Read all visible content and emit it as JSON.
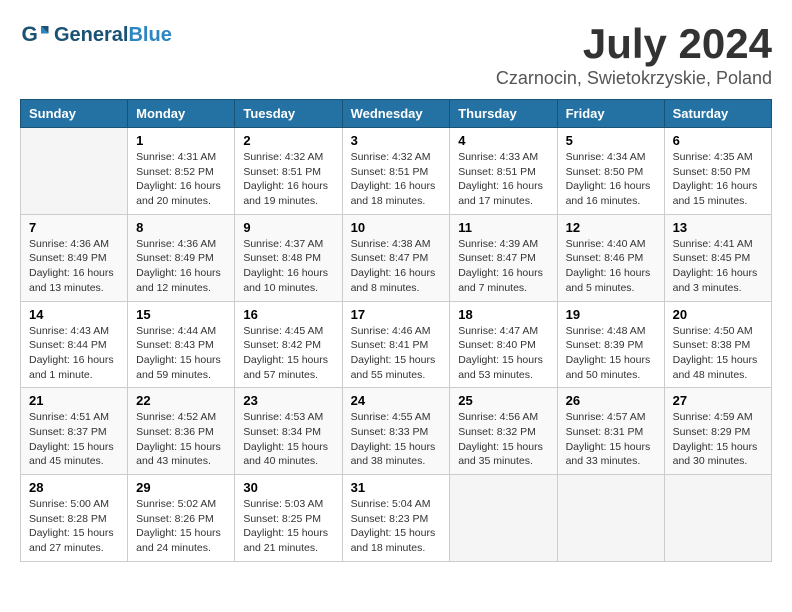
{
  "header": {
    "logo_general": "General",
    "logo_blue": "Blue",
    "month_year": "July 2024",
    "location": "Czarnocin, Swietokrzyskie, Poland"
  },
  "days_of_week": [
    "Sunday",
    "Monday",
    "Tuesday",
    "Wednesday",
    "Thursday",
    "Friday",
    "Saturday"
  ],
  "weeks": [
    [
      {
        "day": "",
        "sunrise": "",
        "sunset": "",
        "daylight": ""
      },
      {
        "day": "1",
        "sunrise": "Sunrise: 4:31 AM",
        "sunset": "Sunset: 8:52 PM",
        "daylight": "Daylight: 16 hours and 20 minutes."
      },
      {
        "day": "2",
        "sunrise": "Sunrise: 4:32 AM",
        "sunset": "Sunset: 8:51 PM",
        "daylight": "Daylight: 16 hours and 19 minutes."
      },
      {
        "day": "3",
        "sunrise": "Sunrise: 4:32 AM",
        "sunset": "Sunset: 8:51 PM",
        "daylight": "Daylight: 16 hours and 18 minutes."
      },
      {
        "day": "4",
        "sunrise": "Sunrise: 4:33 AM",
        "sunset": "Sunset: 8:51 PM",
        "daylight": "Daylight: 16 hours and 17 minutes."
      },
      {
        "day": "5",
        "sunrise": "Sunrise: 4:34 AM",
        "sunset": "Sunset: 8:50 PM",
        "daylight": "Daylight: 16 hours and 16 minutes."
      },
      {
        "day": "6",
        "sunrise": "Sunrise: 4:35 AM",
        "sunset": "Sunset: 8:50 PM",
        "daylight": "Daylight: 16 hours and 15 minutes."
      }
    ],
    [
      {
        "day": "7",
        "sunrise": "Sunrise: 4:36 AM",
        "sunset": "Sunset: 8:49 PM",
        "daylight": "Daylight: 16 hours and 13 minutes."
      },
      {
        "day": "8",
        "sunrise": "Sunrise: 4:36 AM",
        "sunset": "Sunset: 8:49 PM",
        "daylight": "Daylight: 16 hours and 12 minutes."
      },
      {
        "day": "9",
        "sunrise": "Sunrise: 4:37 AM",
        "sunset": "Sunset: 8:48 PM",
        "daylight": "Daylight: 16 hours and 10 minutes."
      },
      {
        "day": "10",
        "sunrise": "Sunrise: 4:38 AM",
        "sunset": "Sunset: 8:47 PM",
        "daylight": "Daylight: 16 hours and 8 minutes."
      },
      {
        "day": "11",
        "sunrise": "Sunrise: 4:39 AM",
        "sunset": "Sunset: 8:47 PM",
        "daylight": "Daylight: 16 hours and 7 minutes."
      },
      {
        "day": "12",
        "sunrise": "Sunrise: 4:40 AM",
        "sunset": "Sunset: 8:46 PM",
        "daylight": "Daylight: 16 hours and 5 minutes."
      },
      {
        "day": "13",
        "sunrise": "Sunrise: 4:41 AM",
        "sunset": "Sunset: 8:45 PM",
        "daylight": "Daylight: 16 hours and 3 minutes."
      }
    ],
    [
      {
        "day": "14",
        "sunrise": "Sunrise: 4:43 AM",
        "sunset": "Sunset: 8:44 PM",
        "daylight": "Daylight: 16 hours and 1 minute."
      },
      {
        "day": "15",
        "sunrise": "Sunrise: 4:44 AM",
        "sunset": "Sunset: 8:43 PM",
        "daylight": "Daylight: 15 hours and 59 minutes."
      },
      {
        "day": "16",
        "sunrise": "Sunrise: 4:45 AM",
        "sunset": "Sunset: 8:42 PM",
        "daylight": "Daylight: 15 hours and 57 minutes."
      },
      {
        "day": "17",
        "sunrise": "Sunrise: 4:46 AM",
        "sunset": "Sunset: 8:41 PM",
        "daylight": "Daylight: 15 hours and 55 minutes."
      },
      {
        "day": "18",
        "sunrise": "Sunrise: 4:47 AM",
        "sunset": "Sunset: 8:40 PM",
        "daylight": "Daylight: 15 hours and 53 minutes."
      },
      {
        "day": "19",
        "sunrise": "Sunrise: 4:48 AM",
        "sunset": "Sunset: 8:39 PM",
        "daylight": "Daylight: 15 hours and 50 minutes."
      },
      {
        "day": "20",
        "sunrise": "Sunrise: 4:50 AM",
        "sunset": "Sunset: 8:38 PM",
        "daylight": "Daylight: 15 hours and 48 minutes."
      }
    ],
    [
      {
        "day": "21",
        "sunrise": "Sunrise: 4:51 AM",
        "sunset": "Sunset: 8:37 PM",
        "daylight": "Daylight: 15 hours and 45 minutes."
      },
      {
        "day": "22",
        "sunrise": "Sunrise: 4:52 AM",
        "sunset": "Sunset: 8:36 PM",
        "daylight": "Daylight: 15 hours and 43 minutes."
      },
      {
        "day": "23",
        "sunrise": "Sunrise: 4:53 AM",
        "sunset": "Sunset: 8:34 PM",
        "daylight": "Daylight: 15 hours and 40 minutes."
      },
      {
        "day": "24",
        "sunrise": "Sunrise: 4:55 AM",
        "sunset": "Sunset: 8:33 PM",
        "daylight": "Daylight: 15 hours and 38 minutes."
      },
      {
        "day": "25",
        "sunrise": "Sunrise: 4:56 AM",
        "sunset": "Sunset: 8:32 PM",
        "daylight": "Daylight: 15 hours and 35 minutes."
      },
      {
        "day": "26",
        "sunrise": "Sunrise: 4:57 AM",
        "sunset": "Sunset: 8:31 PM",
        "daylight": "Daylight: 15 hours and 33 minutes."
      },
      {
        "day": "27",
        "sunrise": "Sunrise: 4:59 AM",
        "sunset": "Sunset: 8:29 PM",
        "daylight": "Daylight: 15 hours and 30 minutes."
      }
    ],
    [
      {
        "day": "28",
        "sunrise": "Sunrise: 5:00 AM",
        "sunset": "Sunset: 8:28 PM",
        "daylight": "Daylight: 15 hours and 27 minutes."
      },
      {
        "day": "29",
        "sunrise": "Sunrise: 5:02 AM",
        "sunset": "Sunset: 8:26 PM",
        "daylight": "Daylight: 15 hours and 24 minutes."
      },
      {
        "day": "30",
        "sunrise": "Sunrise: 5:03 AM",
        "sunset": "Sunset: 8:25 PM",
        "daylight": "Daylight: 15 hours and 21 minutes."
      },
      {
        "day": "31",
        "sunrise": "Sunrise: 5:04 AM",
        "sunset": "Sunset: 8:23 PM",
        "daylight": "Daylight: 15 hours and 18 minutes."
      },
      {
        "day": "",
        "sunrise": "",
        "sunset": "",
        "daylight": ""
      },
      {
        "day": "",
        "sunrise": "",
        "sunset": "",
        "daylight": ""
      },
      {
        "day": "",
        "sunrise": "",
        "sunset": "",
        "daylight": ""
      }
    ]
  ]
}
